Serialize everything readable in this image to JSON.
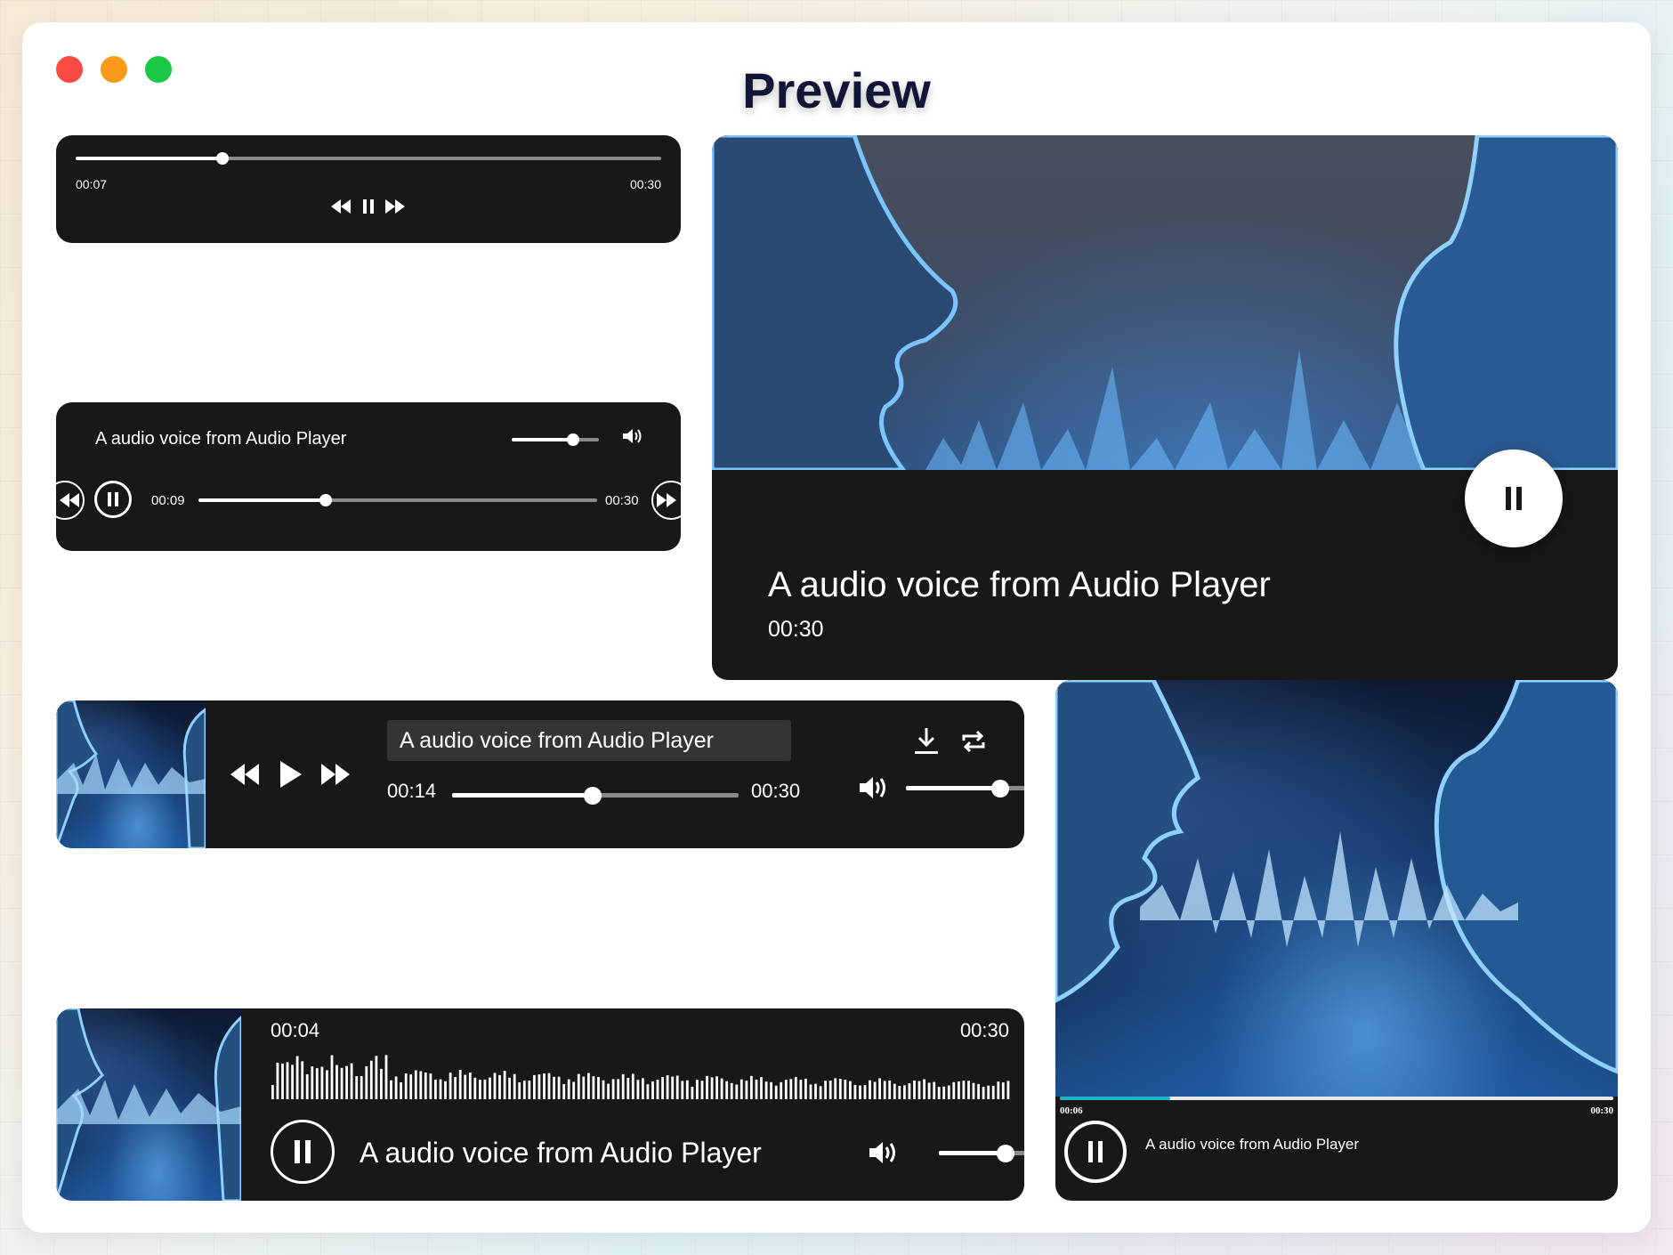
{
  "window": {
    "title": "Preview"
  },
  "players": {
    "mini": {
      "current_time": "00:07",
      "duration": "00:30",
      "progress": 0.25
    },
    "volume_bar": {
      "title": "A audio voice from Audio Player",
      "current_time": "00:09",
      "duration": "00:30",
      "progress": 0.32,
      "volume": 0.7
    },
    "cover_card": {
      "title": "A audio voice from Audio Player",
      "duration": "00:30"
    },
    "toolbar": {
      "title": "A audio voice from Audio Player",
      "current_time": "00:14",
      "duration": "00:30",
      "progress": 0.49,
      "volume": 0.7
    },
    "waveform": {
      "current_time": "00:04",
      "duration": "00:30",
      "title": "A audio voice from Audio Player",
      "volume": 0.75
    },
    "video_card": {
      "current_time": "00:06",
      "duration": "00:30",
      "title": "A audio voice from Audio Player",
      "progress": 0.2
    }
  },
  "colors": {
    "panel": "#181818",
    "accent": "#1fb6c9",
    "close": "#fd4a43",
    "minimize": "#fb9a18",
    "zoom": "#1bc846"
  },
  "icons": [
    "rewind-icon",
    "fast-forward-icon",
    "pause-icon",
    "play-icon",
    "volume-icon",
    "download-icon",
    "repeat-icon"
  ]
}
